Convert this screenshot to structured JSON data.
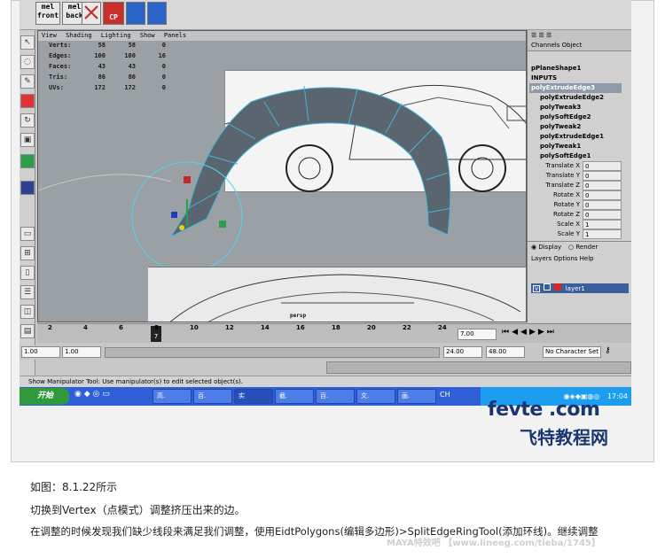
{
  "shelf": {
    "buttons": [
      {
        "label": "mel\nfront"
      },
      {
        "label": "mel\nback"
      },
      {
        "label": "CP"
      }
    ]
  },
  "viewport": {
    "menu": [
      "View",
      "Shading",
      "Lighting",
      "Show",
      "Panels"
    ],
    "hud": [
      {
        "label": "Verts:",
        "a": "58",
        "b": "58",
        "c": "0"
      },
      {
        "label": "Edges:",
        "a": "100",
        "b": "100",
        "c": "16"
      },
      {
        "label": "Faces:",
        "a": "43",
        "b": "43",
        "c": "0"
      },
      {
        "label": "Tris:",
        "a": "86",
        "b": "86",
        "c": "0"
      },
      {
        "label": "UVs:",
        "a": "172",
        "b": "172",
        "c": "0"
      }
    ],
    "camera_label": "persp"
  },
  "channel_box": {
    "tabs": "Channels  Object",
    "shape": "pPlaneShape1",
    "inputs_label": "INPUTS",
    "history": [
      "polyExtrudeEdge3",
      "polyExtrudeEdge2",
      "polyTweak3",
      "polySoftEdge2",
      "polyTweak2",
      "polyExtrudeEdge1",
      "polyTweak1",
      "polySoftEdge1"
    ],
    "attributes": [
      {
        "name": "Translate X",
        "value": "0"
      },
      {
        "name": "Translate Y",
        "value": "0"
      },
      {
        "name": "Translate Z",
        "value": "0"
      },
      {
        "name": "Rotate X",
        "value": "0"
      },
      {
        "name": "Rotate Y",
        "value": "0"
      },
      {
        "name": "Rotate Z",
        "value": "0"
      },
      {
        "name": "Scale X",
        "value": "1"
      },
      {
        "name": "Scale Y",
        "value": "1"
      }
    ],
    "display_label": "Display",
    "render_label": "Render",
    "layer_menu": "Layers  Options  Help",
    "layer_name": "layer1"
  },
  "timeline": {
    "ticks": [
      "2",
      "4",
      "6",
      "8",
      "10",
      "12",
      "14",
      "16",
      "18",
      "20",
      "22",
      "24"
    ],
    "current_frame_field": "7.00",
    "current_marker": "7"
  },
  "range": {
    "start": "1.00",
    "start2": "1.00",
    "end": "24.00",
    "end2": "48.00",
    "character_set": "No Character Set"
  },
  "help_line": "Show Manipulator Tool: Use manipulator(s) to edit selected object(s).",
  "taskbar": {
    "start": "开始",
    "tasks": [
      "高.",
      "百.",
      "实",
      "截.",
      "百.",
      "文.",
      "画."
    ],
    "clock": "17:04",
    "ch": "CH"
  },
  "watermark": {
    "site": "fevte .com",
    "name": "飞特教程网"
  },
  "captions": [
    "如图：8.1.22所示",
    "切换到Vertex（点模式）调整挤压出来的边。",
    "在调整的时候发现我们缺少线段来满足我们调整，使用EidtPolygons(编辑多边形)>SplitEdgeRingTool(添加环线)。继续调整"
  ],
  "footer_watermark": "MAYA特效吧 【www.lineeg.com/tieba/1745】",
  "colors": {
    "mesh": "#5b6570",
    "mesh_edge": "#3fb8d9",
    "taskbar": "#2f5fd6",
    "start": "#2f9a3b",
    "watermark": "#1a3570"
  }
}
